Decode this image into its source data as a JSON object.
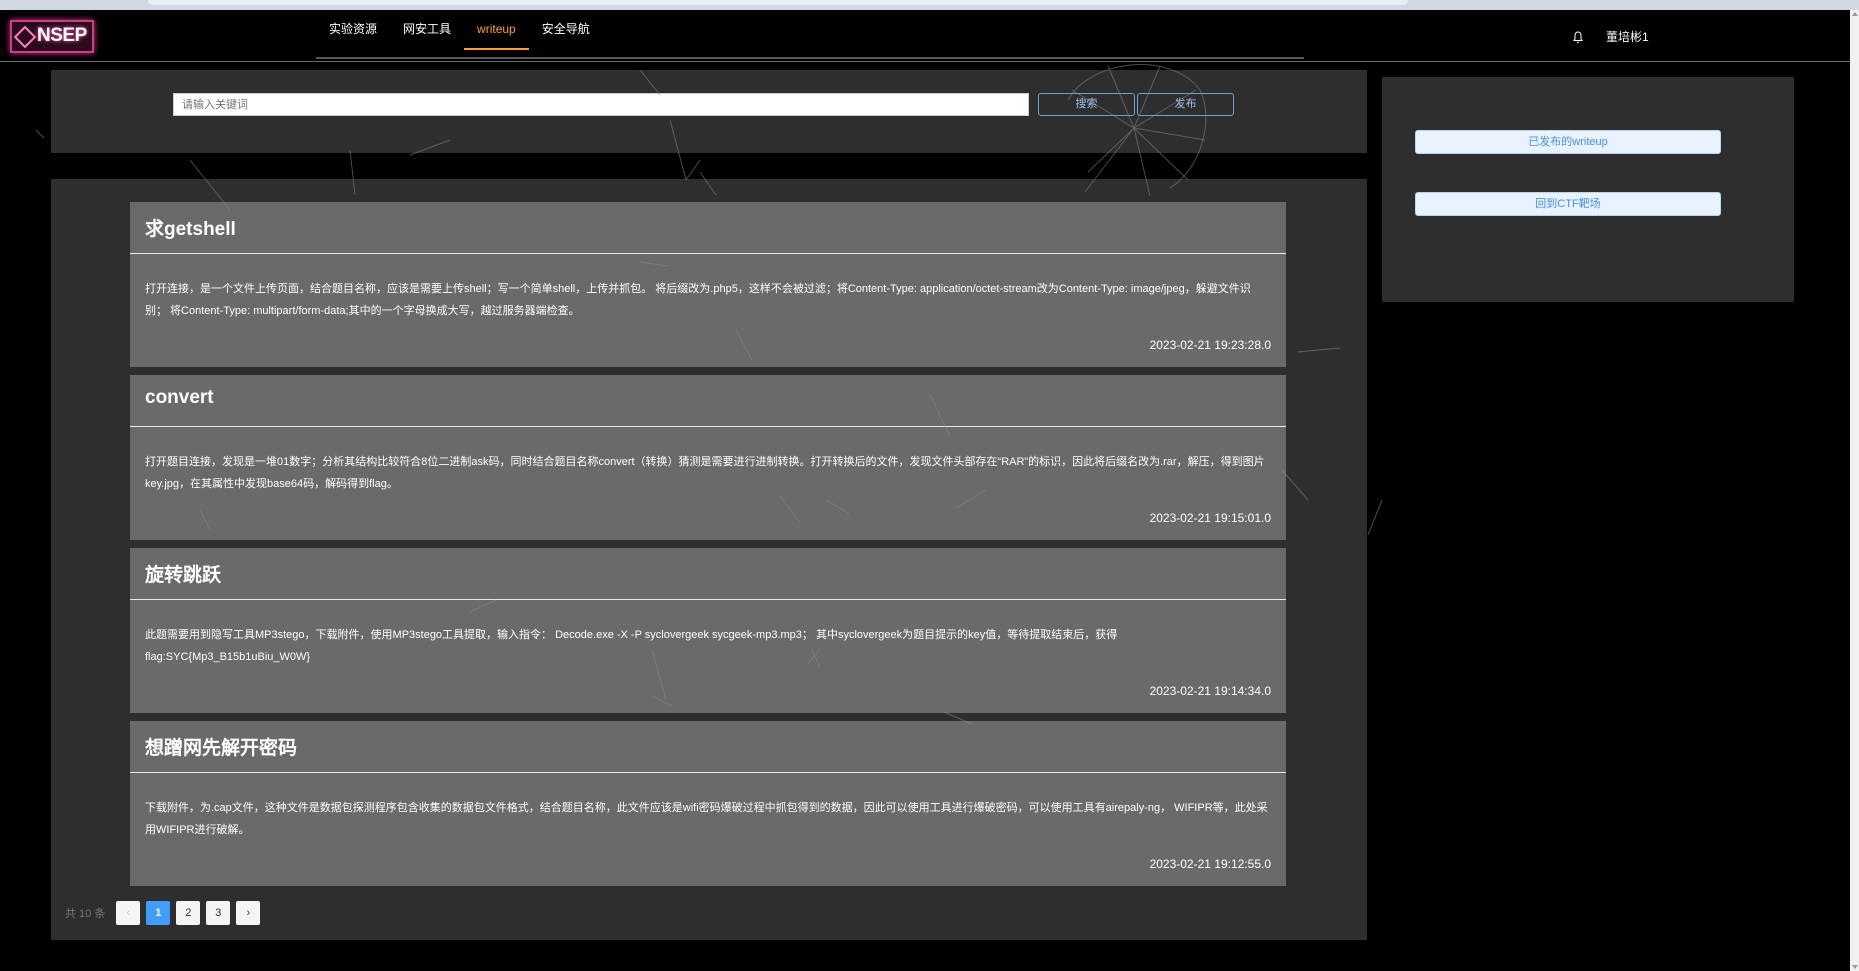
{
  "header": {
    "logo_text": "NSEP",
    "nav": [
      {
        "label": "实验资源",
        "active": false
      },
      {
        "label": "网安工具",
        "active": false
      },
      {
        "label": "writeup",
        "active": true
      },
      {
        "label": "安全导航",
        "active": false
      }
    ],
    "user_name": "董培彬1",
    "bell_icon": "bell-icon"
  },
  "search": {
    "placeholder": "请输入关键词",
    "search_label": "搜索",
    "publish_label": "发布"
  },
  "sidebar": {
    "published_label": "已发布的writeup",
    "back_label": "回到CTF靶场"
  },
  "posts": [
    {
      "title": "求getshell",
      "body": "打开连接，是一个文件上传页面，结合题目名称，应该是需要上传shell；写一个简单shell，上传并抓包。 将后缀改为.php5，这样不会被过滤；将Content-Type: application/octet-stream改为Content-Type: image/jpeg，躲避文件识别； 将Content-Type: multipart/form-data;其中的一个字母换成大写，越过服务器端检查。",
      "date": "2023-02-21 19:23:28.0"
    },
    {
      "title": "convert",
      "body": "打开题目连接，发现是一堆01数字；分析其结构比较符合8位二进制ask码，同时结合题目名称convert（转换）猜测是需要进行进制转换。打开转换后的文件，发现文件头部存在“RAR”的标识，因此将后缀名改为.rar，解压，得到图片key.jpg，在其属性中发现base64码，解码得到flag。",
      "date": "2023-02-21 19:15:01.0"
    },
    {
      "title": "旋转跳跃",
      "body": "此题需要用到隐写工具MP3stego，下载附件，使用MP3stego工具提取，输入指令： Decode.exe -X -P syclovergeek sycgeek-mp3.mp3； 其中syclovergeek为题目提示的key值，等待提取结束后，获得flag:SYC{Mp3_B15b1uBiu_W0W}",
      "date": "2023-02-21 19:14:34.0"
    },
    {
      "title": "想蹭网先解开密码",
      "body": "下载附件，为.cap文件，这种文件是数据包探测程序包含收集的数据包文件格式，结合题目名称，此文件应该是wifi密码爆破过程中抓包得到的数据，因此可以使用工具进行爆破密码，可以使用工具有airepaly-ng， WIFIPR等，此处采用WIFIPR进行破解。",
      "date": "2023-02-21 19:12:55.0"
    }
  ],
  "pagination": {
    "total_text": "共 10 条",
    "prev": "‹",
    "next": "›",
    "pages": [
      "1",
      "2",
      "3"
    ],
    "current": "1"
  },
  "colors": {
    "accent": "#ff9c3a",
    "card": "#6a6a6a",
    "panel": "#2e2e2e",
    "page_active": "#409eff"
  }
}
